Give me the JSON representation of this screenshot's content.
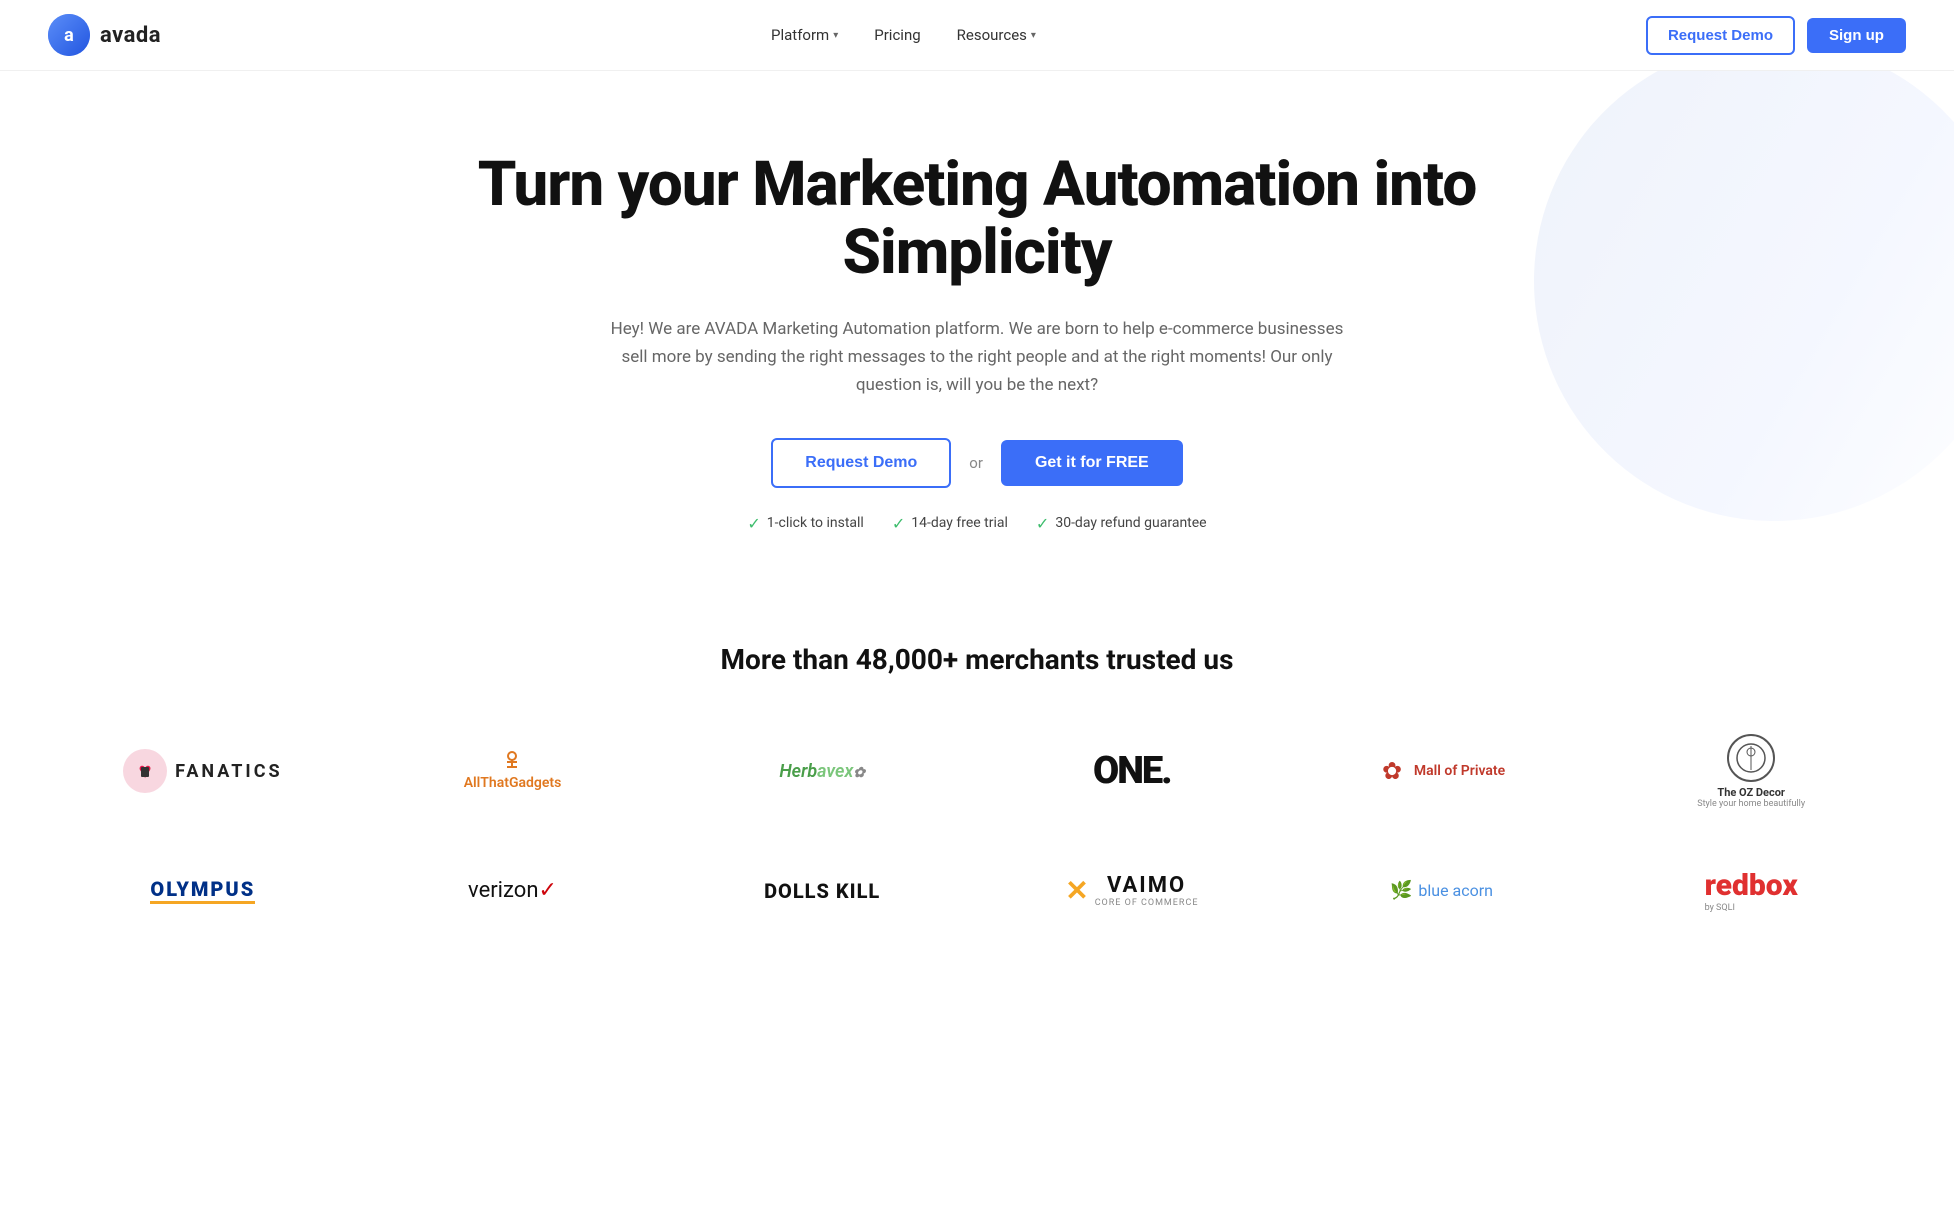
{
  "navbar": {
    "logo_text": "avada",
    "links": [
      {
        "label": "Platform",
        "has_dropdown": true
      },
      {
        "label": "Pricing",
        "has_dropdown": false
      },
      {
        "label": "Resources",
        "has_dropdown": true
      }
    ],
    "request_demo": "Request Demo",
    "sign_up": "Sign up"
  },
  "hero": {
    "title": "Turn your Marketing Automation into Simplicity",
    "subtitle": "Hey! We are AVADA Marketing Automation platform. We are born to help e-commerce businesses sell more by sending the right messages to the right people and at the right moments! Our only question is, will you be the next?",
    "btn_demo": "Request Demo",
    "or_text": "or",
    "btn_free": "Get it for FREE",
    "badges": [
      "1-click to install",
      "14-day free trial",
      "30-day refund guarantee"
    ]
  },
  "trusted": {
    "title": "More than 48,000+ merchants trusted us",
    "logos_row1": [
      {
        "name": "Fanatics",
        "type": "fanatics"
      },
      {
        "name": "AllThatGadgets",
        "type": "allgadgets"
      },
      {
        "name": "Herbavex",
        "type": "herbavex"
      },
      {
        "name": "ONE.",
        "type": "one"
      },
      {
        "name": "Mall of Private",
        "type": "mallofprivate"
      },
      {
        "name": "The OZ Decor",
        "type": "ozdecor"
      }
    ],
    "logos_row2": [
      {
        "name": "OLYMPUS",
        "type": "olympus"
      },
      {
        "name": "verizon",
        "type": "verizon"
      },
      {
        "name": "DOLLS KILL",
        "type": "dollskill"
      },
      {
        "name": "VAIMO",
        "type": "vaimo"
      },
      {
        "name": "blue acorn",
        "type": "blueacorn"
      },
      {
        "name": "redbox",
        "type": "redbox"
      }
    ]
  }
}
